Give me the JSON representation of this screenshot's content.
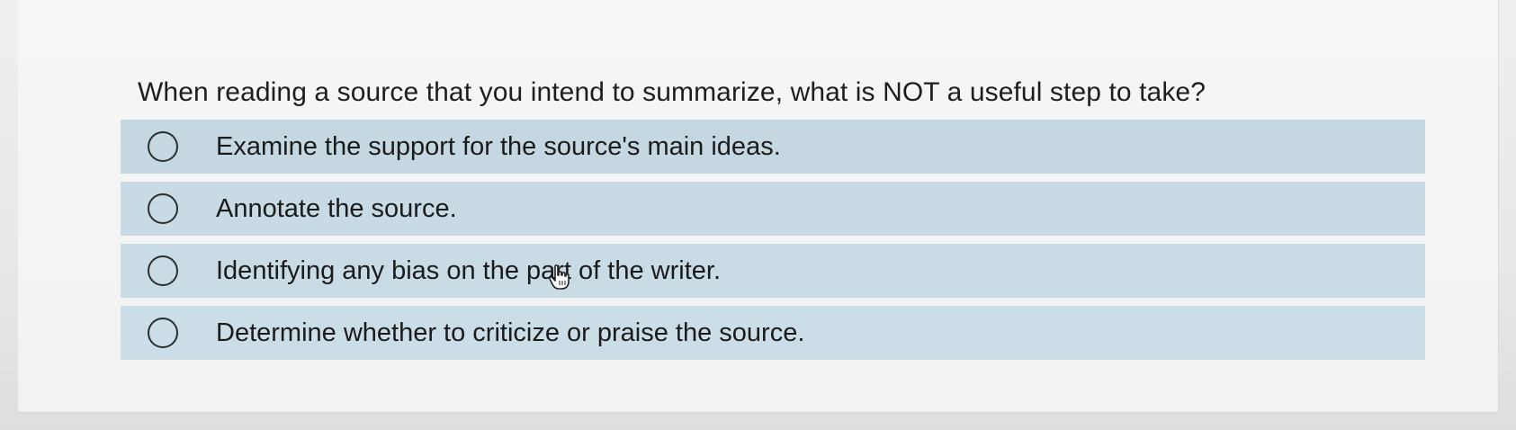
{
  "question": {
    "text": "When reading a source that you intend to summarize, what is NOT a useful step to take?"
  },
  "options": [
    {
      "label": "Examine the support for the source's main ideas.",
      "selected": false
    },
    {
      "label": "Annotate the source.",
      "selected": false
    },
    {
      "label": "Identifying any bias on the part of the writer.",
      "selected": false
    },
    {
      "label": "Determine whether to criticize or praise the source.",
      "selected": false
    }
  ],
  "cursor": {
    "icon": "hand-pointer-icon"
  },
  "colors": {
    "option_background": "#c6d9e3",
    "panel_background": "#f4f4f4",
    "text": "#1e1e1e"
  }
}
